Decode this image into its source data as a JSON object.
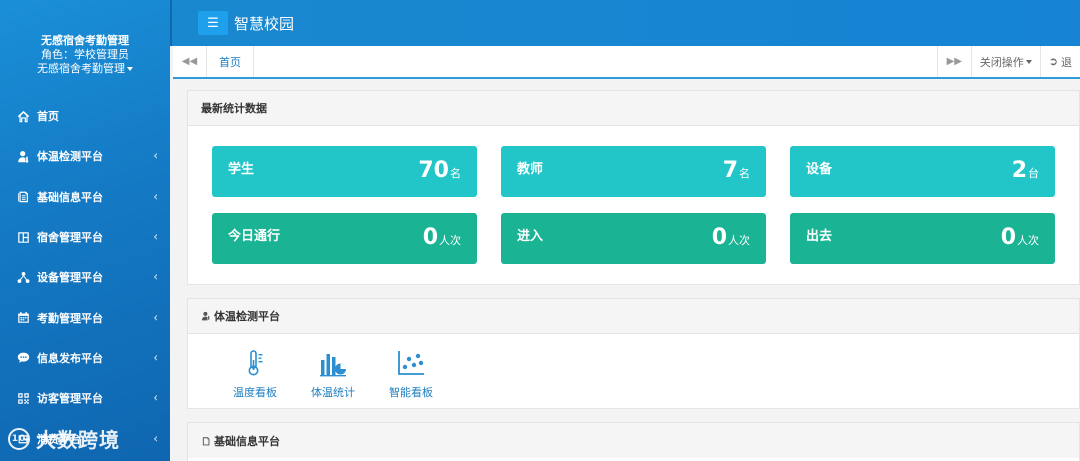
{
  "app": {
    "title": "智慧校园",
    "menu_icon": "hamburger-icon"
  },
  "profile": {
    "name": "无感宿舍考勤管理",
    "role": "角色：学校管理员",
    "dept": "无感宿舍考勤管理"
  },
  "sidebar": {
    "items": [
      {
        "label": "首页",
        "icon": "home-icon"
      },
      {
        "label": "体温检测平台",
        "icon": "user-temperature-icon",
        "arrow": "‹"
      },
      {
        "label": "基础信息平台",
        "icon": "document-icon",
        "arrow": "‹"
      },
      {
        "label": "宿舍管理平台",
        "icon": "layout-icon",
        "arrow": "‹"
      },
      {
        "label": "设备管理平台",
        "icon": "network-icon",
        "arrow": "‹"
      },
      {
        "label": "考勤管理平台",
        "icon": "calendar-icon",
        "arrow": "‹"
      },
      {
        "label": "信息发布平台",
        "icon": "chat-icon",
        "arrow": "‹"
      },
      {
        "label": "访客管理平台",
        "icon": "qrcode-icon",
        "arrow": "‹"
      },
      {
        "label": "消费平台",
        "icon": "wallet-icon",
        "arrow": "‹"
      }
    ]
  },
  "tabsbar": {
    "prev_icon": "double-left-icon",
    "tab_home": "首页",
    "next_icon": "double-right-icon",
    "close_ops": "关闭操作",
    "logout": "退"
  },
  "stats_panel": {
    "title": "最新统计数据",
    "cards": [
      {
        "label": "学生",
        "value": "70",
        "unit": "名",
        "color": "#23c6c8"
      },
      {
        "label": "教师",
        "value": "7",
        "unit": "名",
        "color": "#23c6c8"
      },
      {
        "label": "设备",
        "value": "2",
        "unit": "台",
        "color": "#23c6c8"
      },
      {
        "label": "今日通行",
        "value": "0",
        "unit": "人次",
        "color": "#1ab394"
      },
      {
        "label": "进入",
        "value": "0",
        "unit": "人次",
        "color": "#1ab394"
      },
      {
        "label": "出去",
        "value": "0",
        "unit": "人次",
        "color": "#1ab394"
      }
    ]
  },
  "temp_panel": {
    "title": "体温检测平台",
    "tools": [
      {
        "label": "温度看板",
        "icon": "thermometer-icon"
      },
      {
        "label": "体温统计",
        "icon": "bar-chart-icon"
      },
      {
        "label": "智能看板",
        "icon": "scatter-chart-icon"
      }
    ]
  },
  "base_panel": {
    "title": "基础信息平台"
  },
  "watermark": {
    "text": "大数跨境",
    "logo": "10"
  },
  "colors": {
    "sidebar": "#1479c4",
    "topbar": "#1683d4",
    "teal": "#23c6c8",
    "green": "#1ab394",
    "link": "#1f7fbf"
  }
}
